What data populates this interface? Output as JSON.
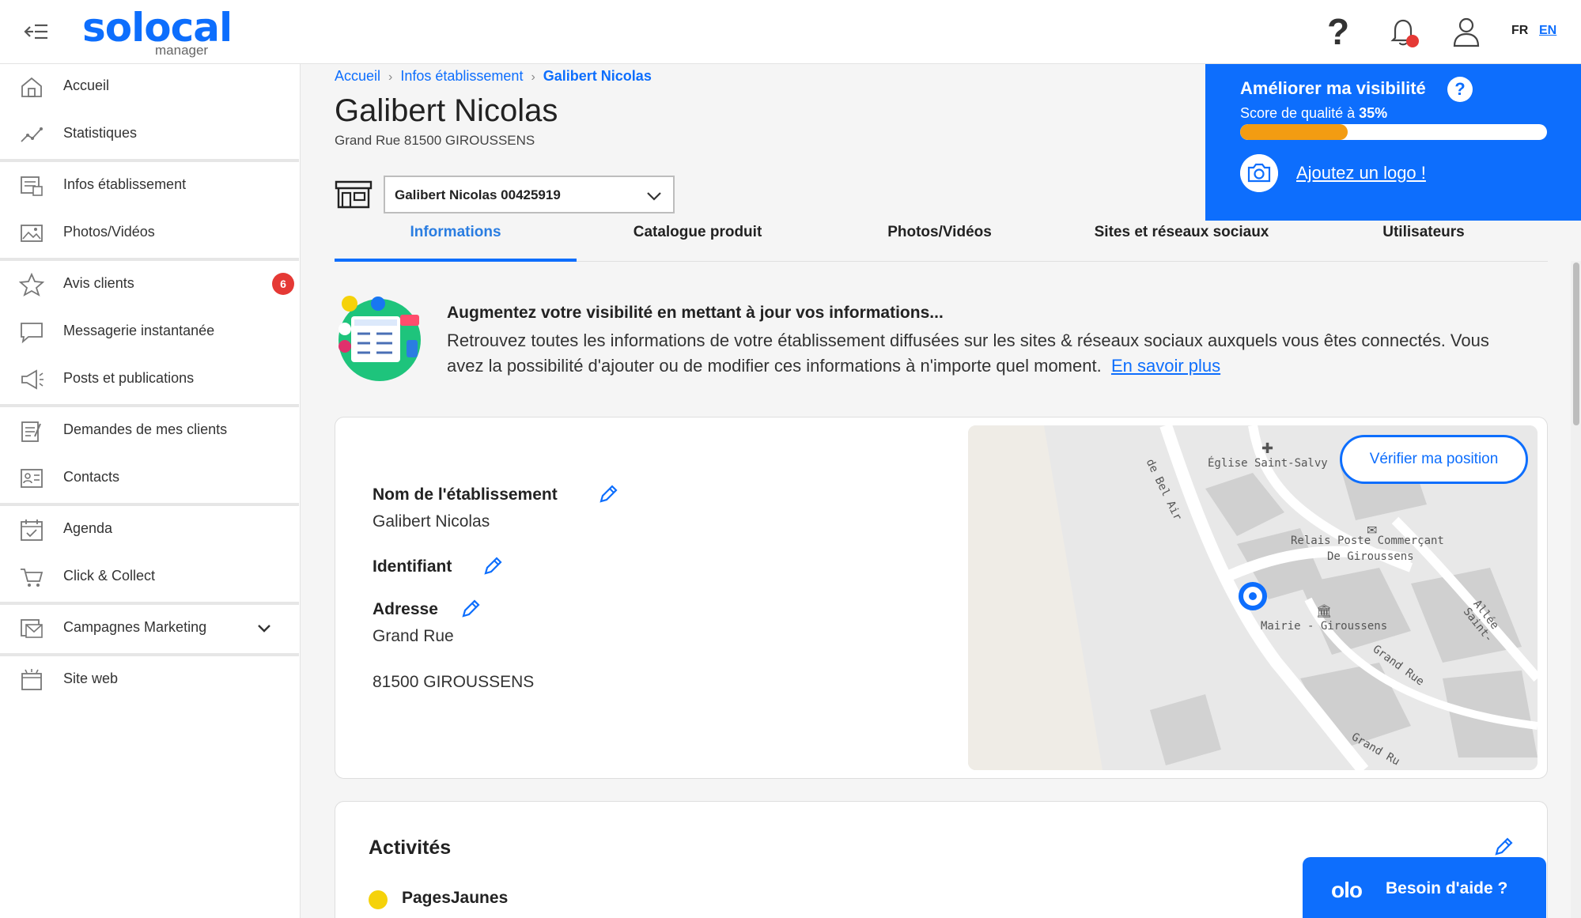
{
  "header": {
    "brand": "solocal",
    "brand_sub": "manager",
    "lang_fr": "FR",
    "lang_en": "EN"
  },
  "sidebar": {
    "items": [
      {
        "label": "Accueil",
        "icon": "home-icon"
      },
      {
        "label": "Statistiques",
        "icon": "trend-chart-icon"
      },
      {
        "label": "Infos établissement",
        "icon": "store-info-icon"
      },
      {
        "label": "Photos/Vidéos",
        "icon": "image-icon"
      },
      {
        "label": "Avis clients",
        "icon": "star-icon",
        "badge": "6"
      },
      {
        "label": "Messagerie instantanée",
        "icon": "chat-bubble-icon"
      },
      {
        "label": "Posts et publications",
        "icon": "megaphone-icon"
      },
      {
        "label": "Demandes de mes clients",
        "icon": "clipboard-icon"
      },
      {
        "label": "Contacts",
        "icon": "contact-card-icon"
      },
      {
        "label": "Agenda",
        "icon": "calendar-icon"
      },
      {
        "label": "Click & Collect",
        "icon": "cart-icon"
      },
      {
        "label": "Campagnes Marketing",
        "icon": "mail-campaign-icon"
      },
      {
        "label": "Site web",
        "icon": "website-icon"
      }
    ]
  },
  "breadcrumb": {
    "home": "Accueil",
    "section": "Infos établissement",
    "current": "Galibert Nicolas"
  },
  "page": {
    "title": "Galibert Nicolas",
    "address": "Grand Rue 81500 GIROUSSENS",
    "selector_value": "Galibert Nicolas 00425919"
  },
  "visibility": {
    "title": "Améliorer ma visibilité",
    "help": "?",
    "score_label": "Score de qualité à ",
    "score_value": "35%",
    "score_fraction": 0.35,
    "cta": "Ajoutez un logo !"
  },
  "tabs": [
    {
      "label": "Informations",
      "active": true
    },
    {
      "label": "Catalogue produit",
      "active": false
    },
    {
      "label": "Photos/Vidéos",
      "active": false
    },
    {
      "label": "Sites et réseaux sociaux",
      "active": false
    },
    {
      "label": "Utilisateurs",
      "active": false
    }
  ],
  "banner": {
    "title": "Augmentez votre visibilité en mettant à jour vos informations...",
    "text": "Retrouvez toutes les informations de votre établissement diffusées sur les sites & réseaux sociaux auxquels vous êtes connectés. Vous avez la possibilité d'ajouter ou de modifier ces informations à n'importe quel moment.",
    "link": "En savoir plus"
  },
  "info_card": {
    "name_label": "Nom de l'établissement",
    "name_value": "Galibert Nicolas",
    "id_label": "Identifiant",
    "address_label": "Adresse",
    "address_line1": "Grand Rue",
    "address_line2": "81500 GIROUSSENS",
    "map_button": "Vérifier ma position",
    "map_labels": {
      "church": "Église Saint-Salvy",
      "post": "Relais Poste Commerçant",
      "post2": "De Giroussens",
      "mairie": "Mairie - Giroussens",
      "street1": "de Bel Air",
      "street2": "Grand Rue",
      "street3": "Allée Saint-",
      "street4": "Grand Ru"
    }
  },
  "activities": {
    "title": "Activités",
    "source": "PagesJaunes"
  },
  "help_button": {
    "logo": "olo",
    "label": "Besoin d'aide ?"
  },
  "colors": {
    "primary": "#0d6efd",
    "progress": "#f39c12",
    "badge": "#e53935",
    "notification_dot": "#e53935"
  }
}
